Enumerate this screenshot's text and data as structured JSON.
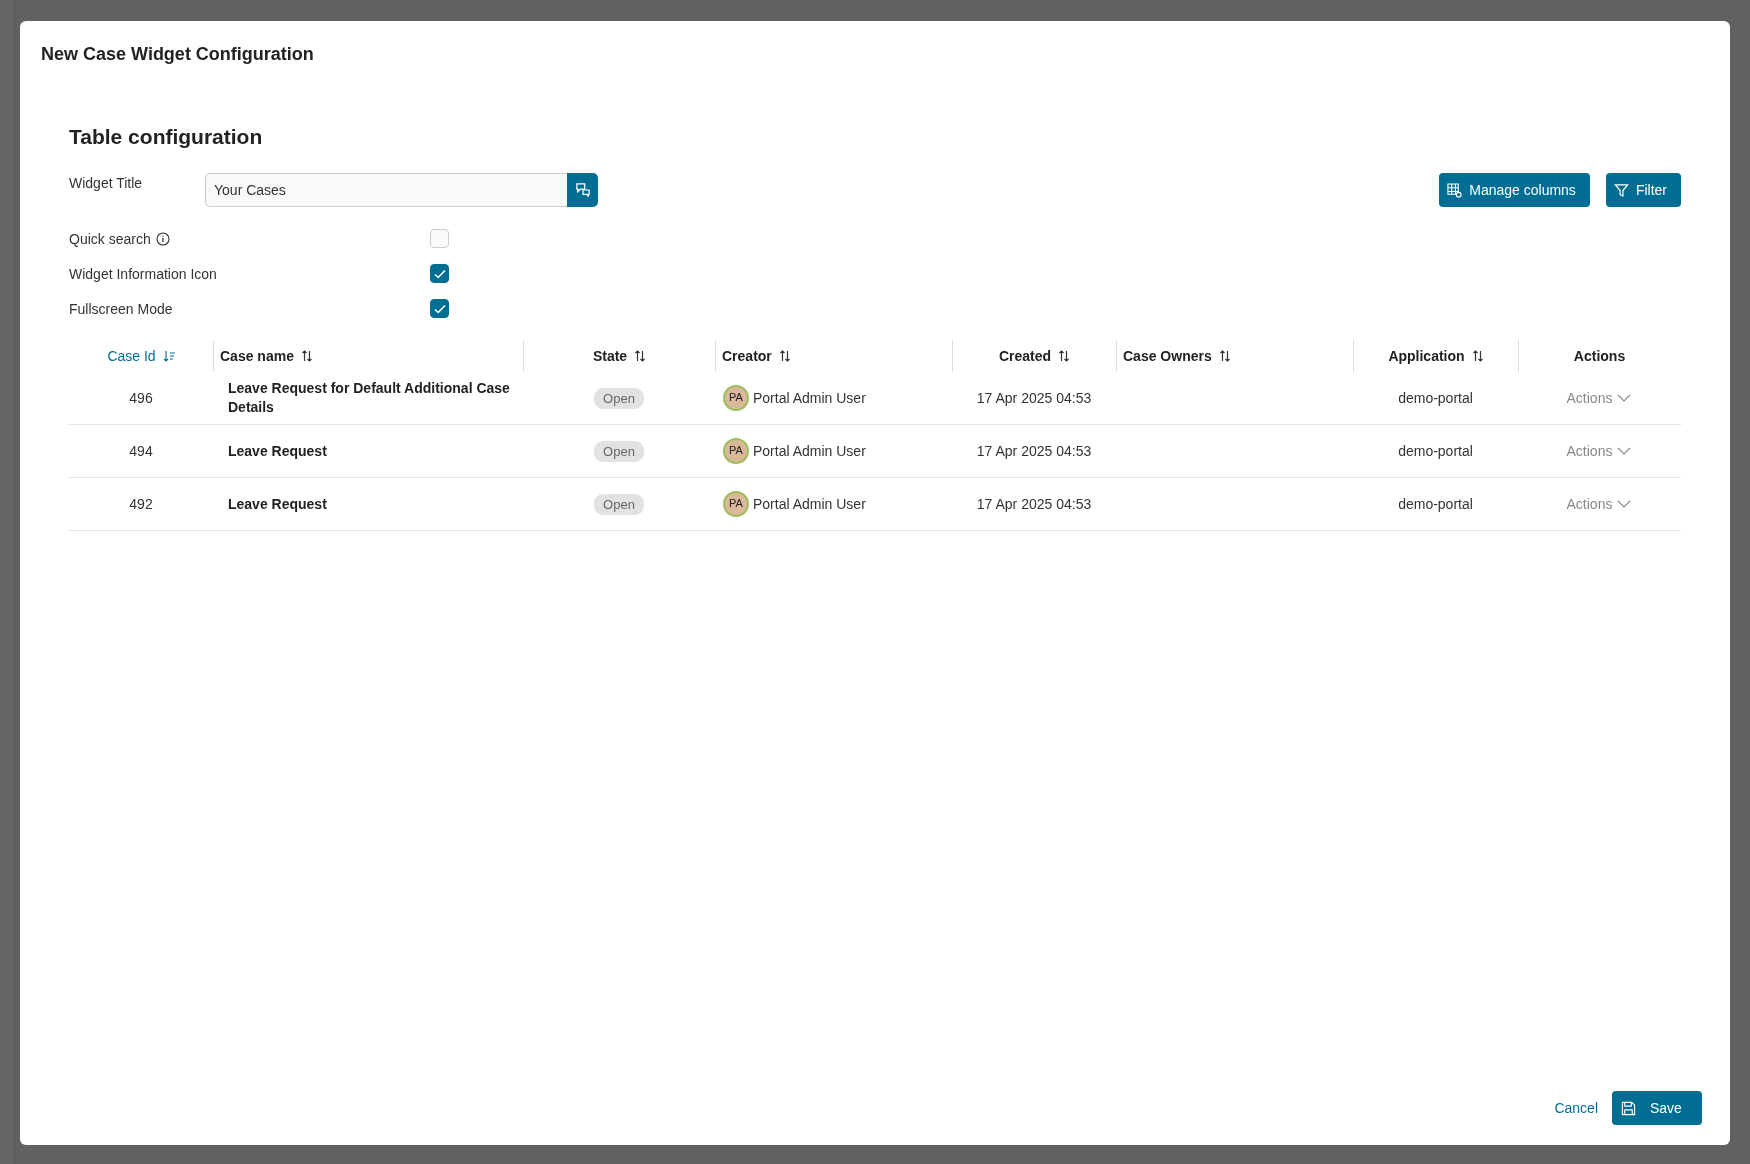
{
  "dialog": {
    "title": "New Case Widget Configuration",
    "section_title": "Table configuration",
    "widget_title": {
      "label": "Widget Title",
      "value": "Your Cases"
    },
    "options": [
      {
        "label": "Quick search",
        "info": true,
        "checked": false
      },
      {
        "label": "Widget Information Icon",
        "info": false,
        "checked": true
      },
      {
        "label": "Fullscreen Mode",
        "info": false,
        "checked": true
      }
    ],
    "toolbar": [
      "Manage columns",
      "Filter"
    ],
    "table": {
      "columns": [
        {
          "label": "Case Id",
          "sortable": true,
          "sorted": true
        },
        {
          "label": "Case name",
          "sortable": true,
          "sorted": false
        },
        {
          "label": "State",
          "sortable": true,
          "sorted": false
        },
        {
          "label": "Creator",
          "sortable": true,
          "sorted": false
        },
        {
          "label": "Created",
          "sortable": true,
          "sorted": false
        },
        {
          "label": "Case Owners",
          "sortable": true,
          "sorted": false
        },
        {
          "label": "Application",
          "sortable": true,
          "sorted": false
        },
        {
          "label": "Actions",
          "sortable": false,
          "sorted": false
        }
      ],
      "rows": [
        {
          "id": "496",
          "name": "Leave Request for Default Additional Case Details",
          "state": "Open",
          "creator": {
            "initials": "PA",
            "name": "Portal Admin User"
          },
          "created": "17 Apr 2025 04:53",
          "application": "demo-portal",
          "actions": "Actions"
        },
        {
          "id": "494",
          "name": "Leave Request",
          "state": "Open",
          "creator": {
            "initials": "PA",
            "name": "Portal Admin User"
          },
          "created": "17 Apr 2025 04:53",
          "application": "demo-portal",
          "actions": "Actions"
        },
        {
          "id": "492",
          "name": "Leave Request",
          "state": "Open",
          "creator": {
            "initials": "PA",
            "name": "Portal Admin User"
          },
          "created": "17 Apr 2025 04:53",
          "application": "demo-portal",
          "actions": "Actions"
        }
      ]
    },
    "footer": {
      "cancel": "Cancel",
      "save": "Save"
    }
  }
}
